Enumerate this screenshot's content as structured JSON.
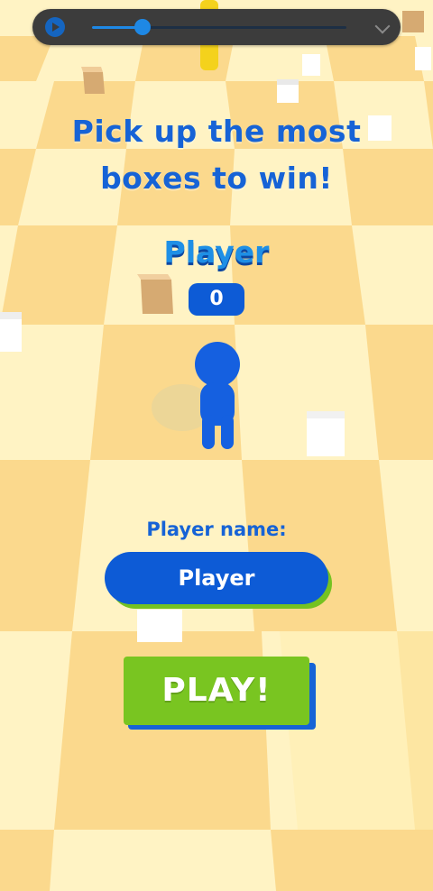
{
  "media_controls": {
    "play_icon": "play-circle-icon",
    "progress": 0.2,
    "accent_color": "#1e88e5",
    "expand_icon": "chevron-down-icon"
  },
  "headline": {
    "line1": "Pick up the most",
    "line2": "boxes to win!"
  },
  "player": {
    "name": "Player",
    "score": "0",
    "color": "#1560e0"
  },
  "form": {
    "name_label": "Player name:",
    "name_value": "Player",
    "play_label": "PLAY!"
  },
  "colors": {
    "text_blue": "#1663d6",
    "button_green": "#79c521",
    "field_blue": "#0d5bd6"
  }
}
